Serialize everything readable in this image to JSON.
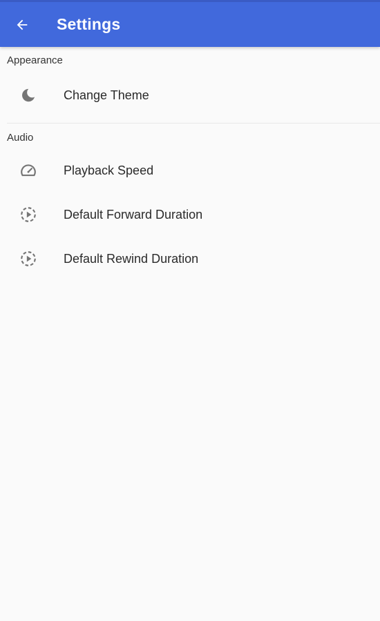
{
  "app_bar": {
    "title": "Settings",
    "back_icon": "arrow-back-icon",
    "color": "#4169dc"
  },
  "sections": [
    {
      "header": "Appearance",
      "items": [
        {
          "label": "Change Theme",
          "icon": "moon-icon"
        }
      ]
    },
    {
      "header": "Audio",
      "items": [
        {
          "label": "Playback Speed",
          "icon": "speedometer-icon"
        },
        {
          "label": "Default Forward Duration",
          "icon": "play-circle-dashed-icon"
        },
        {
          "label": "Default Rewind Duration",
          "icon": "play-circle-dashed-icon"
        }
      ]
    }
  ]
}
